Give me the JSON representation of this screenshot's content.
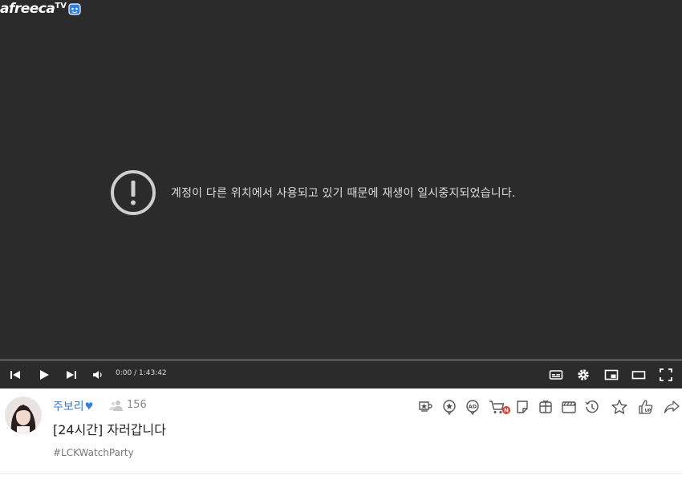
{
  "logo": {
    "text": "afreeca",
    "tv": "TV"
  },
  "notice": {
    "message": "계정이 다른 위치에서 사용되고 있기 때문에 재생이 일시중지되었습니다."
  },
  "player": {
    "time": "0:00 / 1:43:42",
    "progress": 0
  },
  "channel": {
    "streamer_name": "주보리",
    "heart": "♥",
    "viewer_count": "156",
    "title": "[24시간] 자러갑니다",
    "tag": "#LCKWatchParty"
  },
  "colors": {
    "player_bg": "#2b2b2b",
    "streamer": "#3a78d2",
    "badge_red": "#e03a2b"
  },
  "toolbar_icons": [
    "star-balloon-icon",
    "sticker-icon",
    "ad-balloon-icon",
    "shop-cart-icon",
    "quickview-icon",
    "gift-icon",
    "clip-icon",
    "history-icon",
    "favorite-star-icon",
    "up-thumb-icon",
    "share-icon"
  ]
}
